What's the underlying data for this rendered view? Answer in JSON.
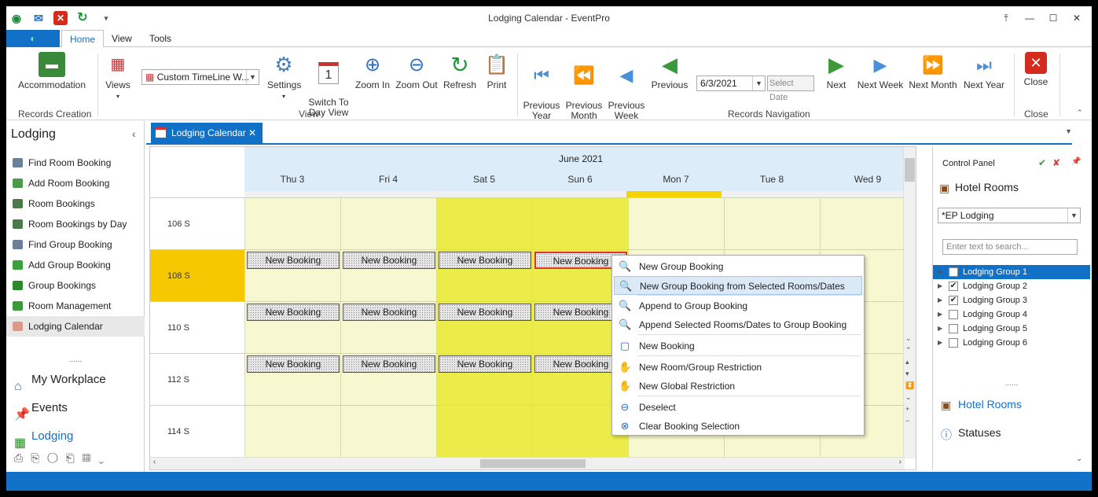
{
  "window": {
    "title": "Lodging Calendar - EventPro"
  },
  "ribbon_tabs": [
    {
      "label": "Home",
      "active": true
    },
    {
      "label": "View",
      "active": false
    },
    {
      "label": "Tools",
      "active": false
    }
  ],
  "ribbon": {
    "accommodation": "Accommodation",
    "records_creation": "Records Creation",
    "views": "Views",
    "view_combo": "Custom TimeLine W...",
    "settings": "Settings",
    "switch_day": "Switch To\nDay View",
    "zoom_in": "Zoom In",
    "zoom_out": "Zoom Out",
    "refresh": "Refresh",
    "print": "Print",
    "view_group": "View",
    "prev_year": "Previous\nYear",
    "prev_month": "Previous\nMonth",
    "prev_week": "Previous\nWeek",
    "previous": "Previous",
    "date_value": "6/3/2021",
    "select_date": "Select Date",
    "next": "Next",
    "next_week": "Next Week",
    "next_month": "Next Month",
    "next_year": "Next Year",
    "records_nav": "Records Navigation",
    "close": "Close",
    "close_group": "Close"
  },
  "nav": {
    "header": "Lodging",
    "items": [
      "Find Room Booking",
      "Add Room Booking",
      "Room Bookings",
      "Room Bookings by Day",
      "Find Group Booking",
      "Add Group Booking",
      "Group Bookings",
      "Room Management",
      "Lodging Calendar"
    ],
    "selected": 8,
    "big": [
      "My Workplace",
      "Events",
      "Lodging"
    ],
    "dots": "......"
  },
  "doc_tab": {
    "label": "Lodging Calendar",
    "close": "✕"
  },
  "calendar": {
    "month": "June 2021",
    "days": [
      "Thu 3",
      "Fri 4",
      "Sat 5",
      "Sun 6",
      "Mon 7",
      "Tue 8",
      "Wed 9"
    ],
    "rooms": [
      "106 S",
      "108 S",
      "110 S",
      "112 S",
      "114 S"
    ],
    "booking_label": "New Booking"
  },
  "control_panel": {
    "title": "Control Panel",
    "section": "Hotel Rooms",
    "combo": "*EP Lodging",
    "search_placeholder": "Enter text to search...",
    "groups": [
      {
        "label": "Lodging Group 1",
        "checked": true
      },
      {
        "label": "Lodging Group 2",
        "checked": true
      },
      {
        "label": "Lodging Group 3",
        "checked": true
      },
      {
        "label": "Lodging Group 4",
        "checked": false
      },
      {
        "label": "Lodging Group 5",
        "checked": false
      },
      {
        "label": "Lodging Group 6",
        "checked": false
      }
    ],
    "bottom": [
      "Hotel Rooms",
      "Statuses"
    ],
    "dots": "......"
  },
  "context_menu": [
    "New Group Booking",
    "New Group Booking from Selected Rooms/Dates",
    "Append to Group Booking",
    "Append Selected Rooms/Dates to Group Booking",
    "New Booking",
    "New Room/Group Restriction",
    "New Global Restriction",
    "Deselect",
    "Clear Booking Selection"
  ]
}
